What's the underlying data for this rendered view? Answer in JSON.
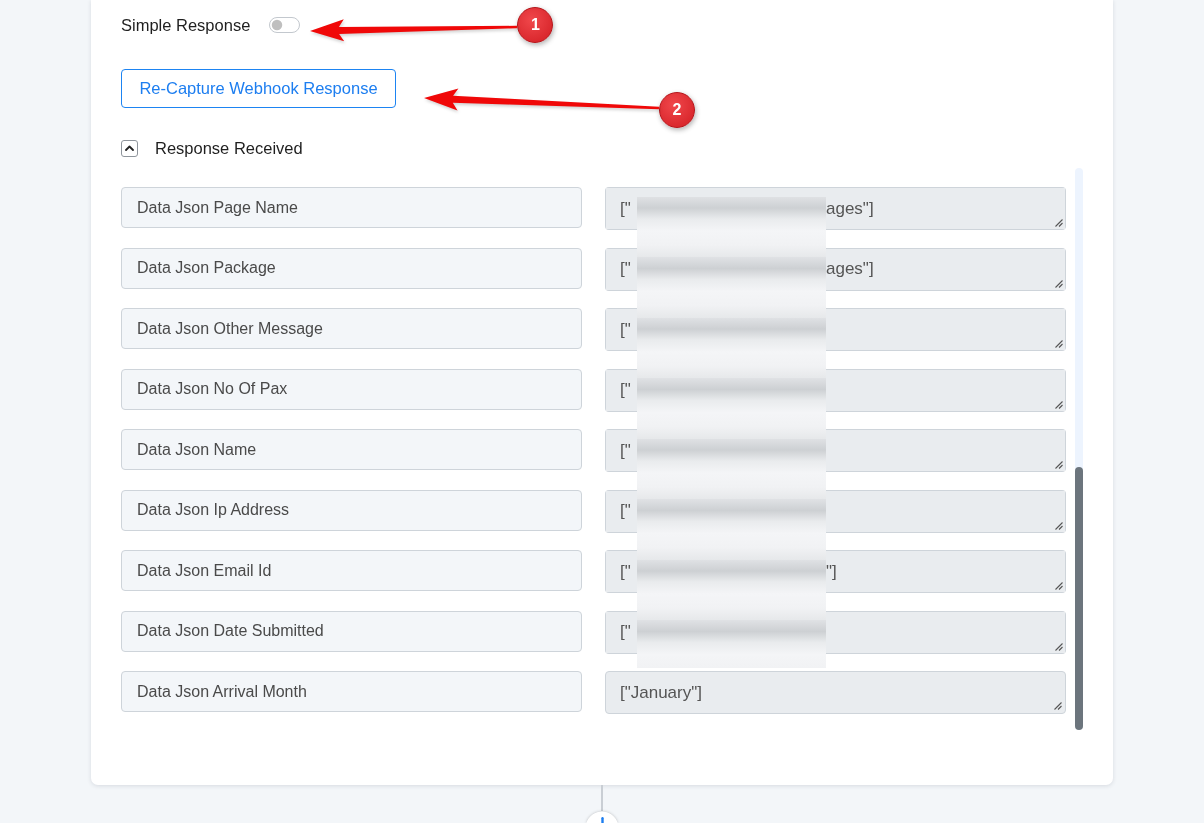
{
  "simple_response": {
    "label": "Simple Response",
    "checked": false,
    "callout": "1"
  },
  "recapture_button": {
    "label": "Re-Capture Webhook Response",
    "callout": "2"
  },
  "response_received": {
    "label": "Response Received",
    "expanded": true,
    "fields": [
      {
        "label": "Data Json Page Name",
        "value": "[\"",
        "value_after_blur": "ages\"]",
        "redacted": true
      },
      {
        "label": "Data Json Package",
        "value": "[\"",
        "value_after_blur": "ages\"]",
        "redacted": true
      },
      {
        "label": "Data Json Other Message",
        "value": "[\"",
        "redacted": true
      },
      {
        "label": "Data Json No Of Pax",
        "value": "[\"",
        "redacted": true
      },
      {
        "label": "Data Json Name",
        "value": "[\"",
        "redacted": true
      },
      {
        "label": "Data Json Ip Address",
        "value": "[\"",
        "redacted": true
      },
      {
        "label": "Data Json Email Id",
        "value": "[\"",
        "value_after_blur": "\"]",
        "redacted": true
      },
      {
        "label": "Data Json Date Submitted",
        "value": "[\"",
        "redacted": true
      },
      {
        "label": "Data Json Arrival Month",
        "value": "[\"January\"]",
        "redacted": false
      }
    ]
  }
}
